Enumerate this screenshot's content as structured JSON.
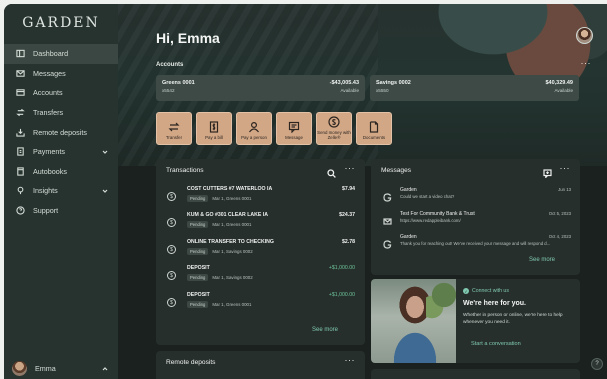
{
  "sidebar": {
    "logo": "GARDEN",
    "items": [
      {
        "label": "Dashboard",
        "icon": "dashboard-icon",
        "active": true
      },
      {
        "label": "Messages",
        "icon": "mail-icon"
      },
      {
        "label": "Accounts",
        "icon": "accounts-icon"
      },
      {
        "label": "Transfers",
        "icon": "transfer-icon"
      },
      {
        "label": "Remote deposits",
        "icon": "deposit-icon"
      },
      {
        "label": "Payments",
        "icon": "payments-icon",
        "expandable": true
      },
      {
        "label": "Autobooks",
        "icon": "autobooks-icon"
      },
      {
        "label": "Insights",
        "icon": "insights-icon",
        "expandable": true
      },
      {
        "label": "Support",
        "icon": "support-icon"
      }
    ],
    "user": {
      "name": "Emma"
    }
  },
  "header": {
    "greeting": "Hi, Emma"
  },
  "accounts": {
    "title": "Accounts",
    "more": "···",
    "list": [
      {
        "name": "Greens 0001",
        "number": "x5542",
        "balance": "-$43,005.43",
        "status": "Available"
      },
      {
        "name": "Savings 0002",
        "number": "x5550",
        "balance": "$40,329.49",
        "status": "Available"
      }
    ]
  },
  "actions": [
    {
      "label": "Transfer",
      "icon": "transfer-icon"
    },
    {
      "label": "Pay a bill",
      "icon": "bill-icon"
    },
    {
      "label": "Pay a person",
      "icon": "person-icon"
    },
    {
      "label": "Message",
      "icon": "message-icon"
    },
    {
      "label": "Send money with Zelle®",
      "icon": "zelle-icon"
    },
    {
      "label": "Documents",
      "icon": "document-icon"
    }
  ],
  "transactions": {
    "title": "Transactions",
    "more": "···",
    "see_more": "See more",
    "rows": [
      {
        "desc": "COST CUTTERS #7 WATERLOO IA",
        "status": "Pending",
        "meta": "Mar 1, Greens 0001",
        "amount": "$7.94",
        "credit": false
      },
      {
        "desc": "KUM & GO #301 CLEAR LAKE IA",
        "status": "Pending",
        "meta": "Mar 1, Greens 0001",
        "amount": "$24.37",
        "credit": false
      },
      {
        "desc": "ONLINE TRANSFER TO CHECKING",
        "status": "Pending",
        "meta": "Mar 1, Savings 0002",
        "amount": "$2.78",
        "credit": false
      },
      {
        "desc": "DEPOSIT",
        "status": "Pending",
        "meta": "Mar 1, Savings 0002",
        "amount": "+$1,000.00",
        "credit": true
      },
      {
        "desc": "DEPOSIT",
        "status": "Pending",
        "meta": "Mar 1, Greens 0001",
        "amount": "+$1,000.00",
        "credit": true
      }
    ]
  },
  "messages": {
    "title": "Messages",
    "more": "···",
    "see_more": "See more",
    "rows": [
      {
        "from": "Garden",
        "preview": "Could we start a video chat?",
        "date": "Jun 13",
        "icon": "garden-g-icon"
      },
      {
        "from": "Test For Community Bank & Trust",
        "preview": "https://www.redappleibank.com/",
        "date": "Oct 5, 2023",
        "icon": "mail-icon"
      },
      {
        "from": "Garden",
        "preview": "Thank you for reaching out! We've received your message and will respond d...",
        "date": "Oct 4, 2023",
        "icon": "garden-g-icon"
      }
    ]
  },
  "promo": {
    "tag": "Connect with us",
    "heading": "We're here for you.",
    "body": "Whether in person or online, we're here to help whenever you need it.",
    "link": "Start a conversation"
  },
  "remote_deposits": {
    "title": "Remote deposits",
    "more": "···"
  },
  "help": "?"
}
